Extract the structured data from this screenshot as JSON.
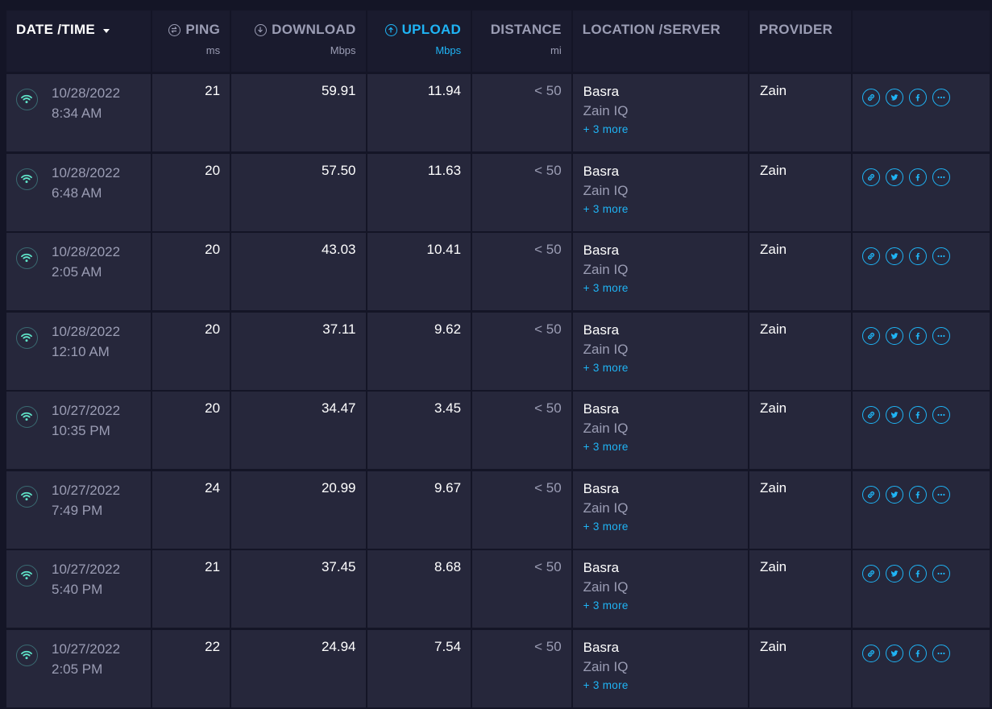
{
  "header": {
    "datetime": "DATE /TIME",
    "ping": "PING",
    "ping_unit": "ms",
    "download": "DOWNLOAD",
    "download_unit": "Mbps",
    "upload": "UPLOAD",
    "upload_unit": "Mbps",
    "distance": "DISTANCE",
    "distance_unit": "mi",
    "location": "LOCATION /SERVER",
    "provider": "PROVIDER"
  },
  "colors": {
    "accent": "#1fb4f5",
    "wifi": "#5fe3c8",
    "row_bg": "#26273b",
    "page_bg": "#141526"
  },
  "icons": {
    "connection": "wifi-icon",
    "actions": [
      "link-icon",
      "twitter-icon",
      "facebook-icon",
      "more-icon"
    ]
  },
  "rows": [
    {
      "date": "10/28/2022",
      "time": "8:34 AM",
      "ping": "21",
      "download": "59.91",
      "upload": "11.94",
      "distance": "< 50",
      "city": "Basra",
      "server": "Zain IQ",
      "more": "+ 3 more",
      "provider": "Zain"
    },
    {
      "date": "10/28/2022",
      "time": "6:48 AM",
      "ping": "20",
      "download": "57.50",
      "upload": "11.63",
      "distance": "< 50",
      "city": "Basra",
      "server": "Zain IQ",
      "more": "+ 3 more",
      "provider": "Zain"
    },
    {
      "date": "10/28/2022",
      "time": "2:05 AM",
      "ping": "20",
      "download": "43.03",
      "upload": "10.41",
      "distance": "< 50",
      "city": "Basra",
      "server": "Zain IQ",
      "more": "+ 3 more",
      "provider": "Zain"
    },
    {
      "date": "10/28/2022",
      "time": "12:10 AM",
      "ping": "20",
      "download": "37.11",
      "upload": "9.62",
      "distance": "< 50",
      "city": "Basra",
      "server": "Zain IQ",
      "more": "+ 3 more",
      "provider": "Zain"
    },
    {
      "date": "10/27/2022",
      "time": "10:35 PM",
      "ping": "20",
      "download": "34.47",
      "upload": "3.45",
      "distance": "< 50",
      "city": "Basra",
      "server": "Zain IQ",
      "more": "+ 3 more",
      "provider": "Zain"
    },
    {
      "date": "10/27/2022",
      "time": "7:49 PM",
      "ping": "24",
      "download": "20.99",
      "upload": "9.67",
      "distance": "< 50",
      "city": "Basra",
      "server": "Zain IQ",
      "more": "+ 3 more",
      "provider": "Zain"
    },
    {
      "date": "10/27/2022",
      "time": "5:40 PM",
      "ping": "21",
      "download": "37.45",
      "upload": "8.68",
      "distance": "< 50",
      "city": "Basra",
      "server": "Zain IQ",
      "more": "+ 3 more",
      "provider": "Zain"
    },
    {
      "date": "10/27/2022",
      "time": "2:05 PM",
      "ping": "22",
      "download": "24.94",
      "upload": "7.54",
      "distance": "< 50",
      "city": "Basra",
      "server": "Zain IQ",
      "more": "+ 3 more",
      "provider": "Zain"
    }
  ]
}
